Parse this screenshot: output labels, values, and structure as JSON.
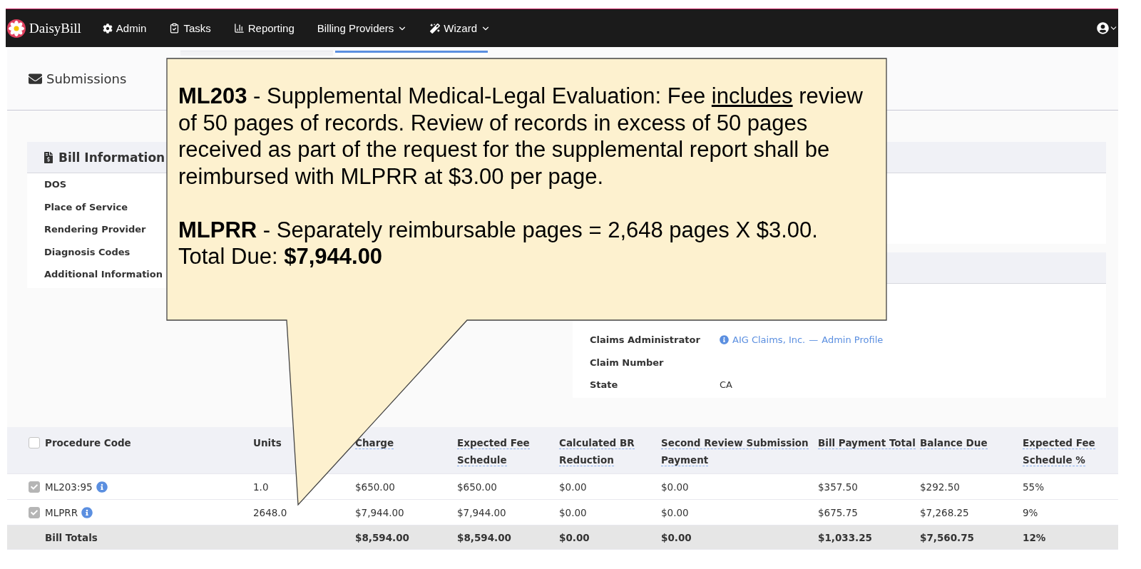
{
  "nav": {
    "brand": "DaisyBill",
    "items": [
      {
        "label": "Admin",
        "dropdown": false
      },
      {
        "label": "Tasks",
        "dropdown": false
      },
      {
        "label": "Reporting",
        "dropdown": false
      },
      {
        "label": "Billing Providers",
        "dropdown": true
      },
      {
        "label": "Wizard",
        "dropdown": true
      }
    ],
    "user_dropdown": true
  },
  "page_header": {
    "title": "Submissions"
  },
  "tabs": [
    {
      "selected": false
    },
    {
      "selected": true
    }
  ],
  "bill_information": {
    "title": "Bill Information",
    "fields": [
      "DOS",
      "Place of Service",
      "Rendering Provider",
      "Diagnosis Codes",
      "Additional Information"
    ]
  },
  "claim": {
    "fields": [
      {
        "label": "Claims Administrator",
        "link": "AIG Claims, Inc.",
        "separator": "—",
        "link_2": "Admin Profile"
      },
      {
        "label": "Claim Number"
      },
      {
        "label": "State",
        "value": "CA"
      }
    ]
  },
  "table": {
    "all_checked": false,
    "columns": [
      {
        "label": "Procedure Code",
        "dotted": false
      },
      {
        "label": "Units",
        "dotted": false
      },
      {
        "label": "Charge",
        "dotted": true
      },
      {
        "label": "Expected Fee Schedule",
        "dotted": true
      },
      {
        "label": "Calculated BR Reduction",
        "dotted": true
      },
      {
        "label": "Second Review Submission Payment",
        "dotted": true
      },
      {
        "label": "Bill Payment Total",
        "dotted": true
      },
      {
        "label": "Balance Due",
        "dotted": true
      },
      {
        "label": "Expected Fee Schedule %",
        "dotted": true
      }
    ],
    "rows": [
      {
        "checked": true,
        "cells": [
          "ML203:95",
          "1.0",
          "$650.00",
          "$650.00",
          "$0.00",
          "$0.00",
          "$357.50",
          "$292.50",
          "55%"
        ]
      },
      {
        "checked": true,
        "cells": [
          "MLPRR",
          "2648.0",
          "$7,944.00",
          "$7,944.00",
          "$0.00",
          "$0.00",
          "$675.75",
          "$7,268.25",
          "9%"
        ]
      }
    ],
    "totals": {
      "cells": [
        "Bill Totals",
        "",
        "$8,594.00",
        "$8,594.00",
        "$0.00",
        "$0.00",
        "$1,033.25",
        "$7,560.75",
        "12%"
      ]
    }
  },
  "callout": {
    "paragraphs": [
      [
        {
          "text": "**ML203** - Supplemental Medical-Legal Evaluation: Fee ",
          "kind": "plain"
        },
        {
          "text": "includes",
          "kind": "underline"
        },
        {
          "text": " review of 50 pages of records. Review of records in excess of 50 pages received as part of the request for the supplemental report shall be reimbursed with MLPRR at $3.00 per page.",
          "kind": "plain"
        }
      ],
      [
        {
          "text": "**MLPRR** - Separately reimbursable pages = 2,648 pages X $3.00. Total Due: **$7,944.00**",
          "kind": "plain"
        }
      ]
    ]
  }
}
